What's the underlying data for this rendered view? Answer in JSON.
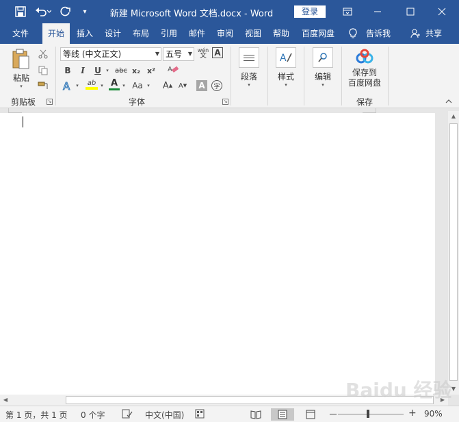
{
  "titlebar": {
    "title": "新建 Microsoft Word 文档.docx  -  Word",
    "login_label": "登录",
    "save_icon": "save-icon",
    "undo_icon": "undo-icon",
    "redo_icon": "redo-icon"
  },
  "tabs": [
    {
      "label": "文件"
    },
    {
      "label": "开始"
    },
    {
      "label": "插入"
    },
    {
      "label": "设计"
    },
    {
      "label": "布局"
    },
    {
      "label": "引用"
    },
    {
      "label": "邮件"
    },
    {
      "label": "审阅"
    },
    {
      "label": "视图"
    },
    {
      "label": "帮助"
    },
    {
      "label": "百度网盘"
    },
    {
      "label": "告诉我"
    },
    {
      "label": "共享"
    }
  ],
  "ribbon": {
    "clipboard": {
      "paste_label": "粘贴",
      "group_label": "剪贴板"
    },
    "font": {
      "font_name": "等线 (中文正文)",
      "font_size": "五号",
      "phonetic_label": "wén",
      "bold": "B",
      "italic": "I",
      "underline": "U",
      "strike": "abc",
      "subscript": "x₂",
      "superscript": "x²",
      "highlight": "ab",
      "font_color": "A",
      "change_case": "Aa",
      "grow": "A",
      "shrink": "A",
      "char_shading": "A",
      "enclose": "字",
      "group_label": "字体"
    },
    "paragraph": {
      "label": "段落"
    },
    "styles": {
      "label": "样式"
    },
    "editing": {
      "label": "编辑"
    },
    "baidu": {
      "label_line1": "保存到",
      "label_line2": "百度网盘",
      "group_label": "保存"
    }
  },
  "statusbar": {
    "page": "第 1 页，共 1 页",
    "words": "0 个字",
    "language": "中文(中国)",
    "zoom": "90%",
    "zoom_minus": "－",
    "zoom_plus": "+"
  },
  "watermark": "Baidu 经验"
}
